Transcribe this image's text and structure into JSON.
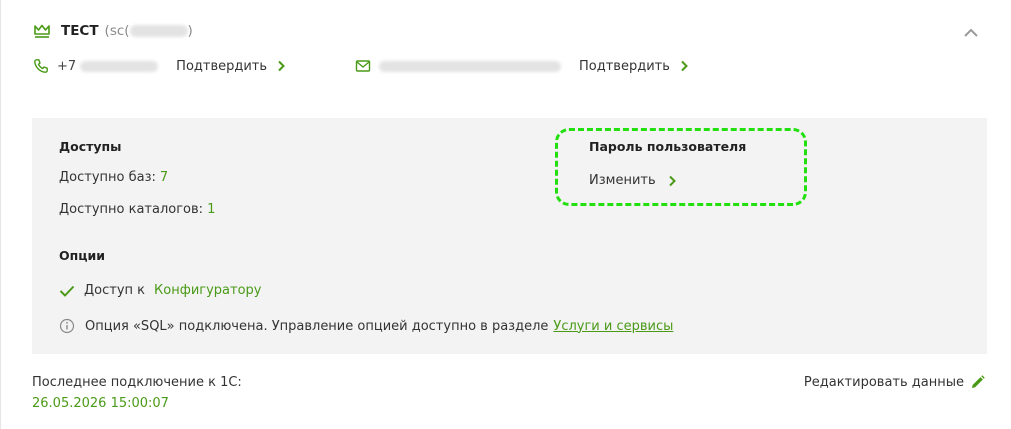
{
  "user": {
    "name": "ТЕСТ",
    "login_prefix": "(sc(",
    "login_suffix": ")"
  },
  "contacts": {
    "phone_prefix": "+7",
    "phone_confirm": "Подтвердить",
    "email_confirm": "Подтвердить"
  },
  "access": {
    "heading": "Доступы",
    "bases_label": "Доступно баз:",
    "bases_value": "7",
    "catalogs_label": "Доступно каталогов:",
    "catalogs_value": "1"
  },
  "password": {
    "heading": "Пароль пользователя",
    "change_label": "Изменить"
  },
  "options": {
    "heading": "Опции",
    "configurator_prefix": "Доступ к",
    "configurator_link": "Конфигуратору",
    "sql_text": "Опция «SQL» подключена. Управление опцией доступно в разделе",
    "sql_link": "Услуги и сервисы"
  },
  "footer": {
    "last_connection_label": "Последнее подключение к 1С:",
    "last_connection_date": "26.05.2026 15:00:07",
    "edit_label": "Редактировать данные"
  },
  "colors": {
    "accent": "#4a9a17",
    "highlight": "#22e00e",
    "panel_bg": "#f3f3f3"
  },
  "icons": [
    "crown-icon",
    "chevron-up-icon",
    "phone-icon",
    "mail-icon",
    "chevron-right-icon",
    "check-icon",
    "info-icon",
    "pencil-icon"
  ]
}
